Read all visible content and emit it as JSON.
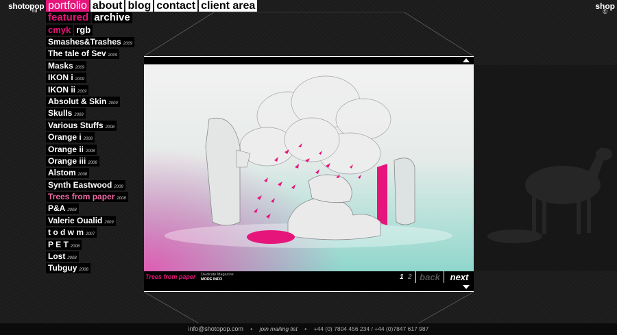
{
  "brand": {
    "logo": "shotopop",
    "logo_sub": "ltd",
    "logo_right": "shop",
    "logo_right_sub": "©"
  },
  "topnav": [
    {
      "label": "portfolio",
      "active": true
    },
    {
      "label": "about",
      "active": false
    },
    {
      "label": "blog",
      "active": false
    },
    {
      "label": "contact",
      "active": false
    },
    {
      "label": "client area",
      "active": false
    }
  ],
  "subnav": [
    {
      "label": "featured",
      "active": true
    },
    {
      "label": "archive",
      "active": false
    }
  ],
  "tertnav": [
    {
      "label": "cmyk",
      "active": true
    },
    {
      "label": "rgb",
      "active": false
    }
  ],
  "projects": [
    {
      "name": "Smashes&Trashes",
      "year": "2009"
    },
    {
      "name": "The tale of Sev",
      "year": "2009"
    },
    {
      "name": "Masks",
      "year": "2009"
    },
    {
      "name": "IKON i",
      "year": "2009"
    },
    {
      "name": "IKON ii",
      "year": "2009"
    },
    {
      "name": "Absolut & Skin",
      "year": "2009"
    },
    {
      "name": "Skulls",
      "year": "2009"
    },
    {
      "name": "Various Stuffs",
      "year": "2008"
    },
    {
      "name": "Orange i",
      "year": "2008"
    },
    {
      "name": "Orange ii",
      "year": "2008"
    },
    {
      "name": "Orange iii",
      "year": "2008"
    },
    {
      "name": "Alstom",
      "year": "2008"
    },
    {
      "name": "Synth Eastwood",
      "year": "2008"
    },
    {
      "name": "Trees from paper",
      "year": "2008",
      "active": true
    },
    {
      "name": "P&A",
      "year": "2008"
    },
    {
      "name": "Valerie Oualid",
      "year": "2009"
    },
    {
      "name": "t o d w m",
      "year": "2007"
    },
    {
      "name": "P E T",
      "year": "2008"
    },
    {
      "name": "Lost",
      "year": "2008"
    },
    {
      "name": "Tubguy",
      "year": "2008"
    }
  ],
  "viewer": {
    "title": "Trees from paper",
    "client": "DEdicate Magazine",
    "more_info": "MORE INFO",
    "pages": [
      "1",
      "2"
    ],
    "back_label": "back",
    "next_label": "next"
  },
  "footer": {
    "email": "info@shotopop.com",
    "mailing": "join mailing list",
    "phones": "+44 (0) 7804 456 234 / +44 (0)7847 617 987"
  },
  "colors": {
    "accent": "#e6157c",
    "background": "#1c1c1c"
  }
}
